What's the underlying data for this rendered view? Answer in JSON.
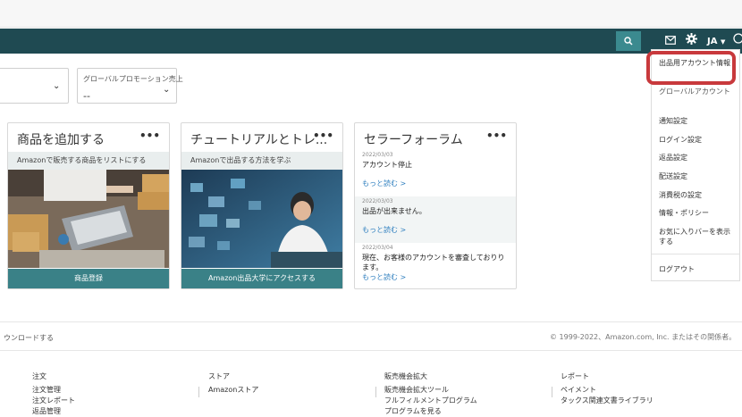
{
  "header": {
    "user_label": "JA",
    "icons": [
      "search-icon",
      "mail-icon",
      "gear-icon",
      "chevron-down-icon",
      "help-icon"
    ]
  },
  "filters": {
    "global_promo_label": "グローバルプロモーション売上",
    "global_promo_value": "--"
  },
  "cards": [
    {
      "title": "商品を追加する",
      "menu": "•••",
      "subtitle": "Amazonで販売する商品をリストにする",
      "button": "商品登録"
    },
    {
      "title": "チュートリアルとトレ...",
      "menu": "•••",
      "subtitle": "Amazonで出品する方法を学ぶ",
      "button": "Amazon出品大学にアクセスする"
    }
  ],
  "forum": {
    "title": "セラーフォーラム",
    "menu": "•••",
    "items": [
      {
        "date": "2022/03/03",
        "text": "アカウント停止",
        "more": "もっと読む >"
      },
      {
        "date": "2022/03/03",
        "text": "出品が出来ません。",
        "more": "もっと読む >"
      },
      {
        "date": "2022/03/04",
        "text": "現在、お客様のアカウントを審査しておりります。",
        "more": "もっと読む >"
      }
    ]
  },
  "dropdown": {
    "items": [
      "出品用アカウント情報",
      "グローバルアカウント",
      "通知設定",
      "ログイン設定",
      "返品設定",
      "配送設定",
      "消費税の設定",
      "情報・ポリシー",
      "お気に入りバーを表示する",
      "ログアウト"
    ]
  },
  "footer": {
    "download_text": "ウンロードする",
    "copyright": "© 1999-2022、Amazon.com, Inc. またはその関係者。",
    "columns": [
      {
        "heading": "注文",
        "links": [
          "注文管理",
          "注文レポート",
          "返品管理"
        ]
      },
      {
        "heading": "ストア",
        "links": [
          "Amazonストア"
        ]
      },
      {
        "heading": "販売機会拡大",
        "links": [
          "販売機会拡大ツール",
          "フルフィルメントプログラム",
          "プログラムを見る"
        ]
      },
      {
        "heading": "レポート",
        "links": [
          "ペイメント",
          "タックス関連文書ライブラリ"
        ]
      }
    ]
  },
  "colors": {
    "navbar": "#1f4a52",
    "accent": "#3a8187",
    "highlight": "#c8393c",
    "link": "#2f7fbf"
  }
}
